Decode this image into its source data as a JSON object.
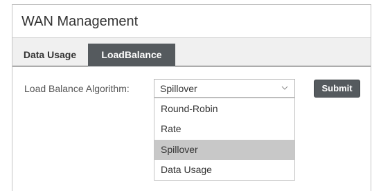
{
  "header": {
    "title": "WAN Management"
  },
  "tabs": [
    {
      "label": "Data Usage",
      "active": false
    },
    {
      "label": "LoadBalance",
      "active": true
    }
  ],
  "form": {
    "algorithm_label": "Load Balance Algorithm:",
    "selected_value": "Spillover",
    "options": [
      "Round-Robin",
      "Rate",
      "Spillover",
      "Data Usage"
    ],
    "highlighted_option": "Spillover",
    "submit_label": "Submit"
  },
  "colors": {
    "active_tab_bg": "#555a5e",
    "submit_bg": "#555a5e",
    "highlight_bg": "#c8c8c8"
  },
  "icons": {
    "select_arrow": "chevron-down-icon"
  }
}
